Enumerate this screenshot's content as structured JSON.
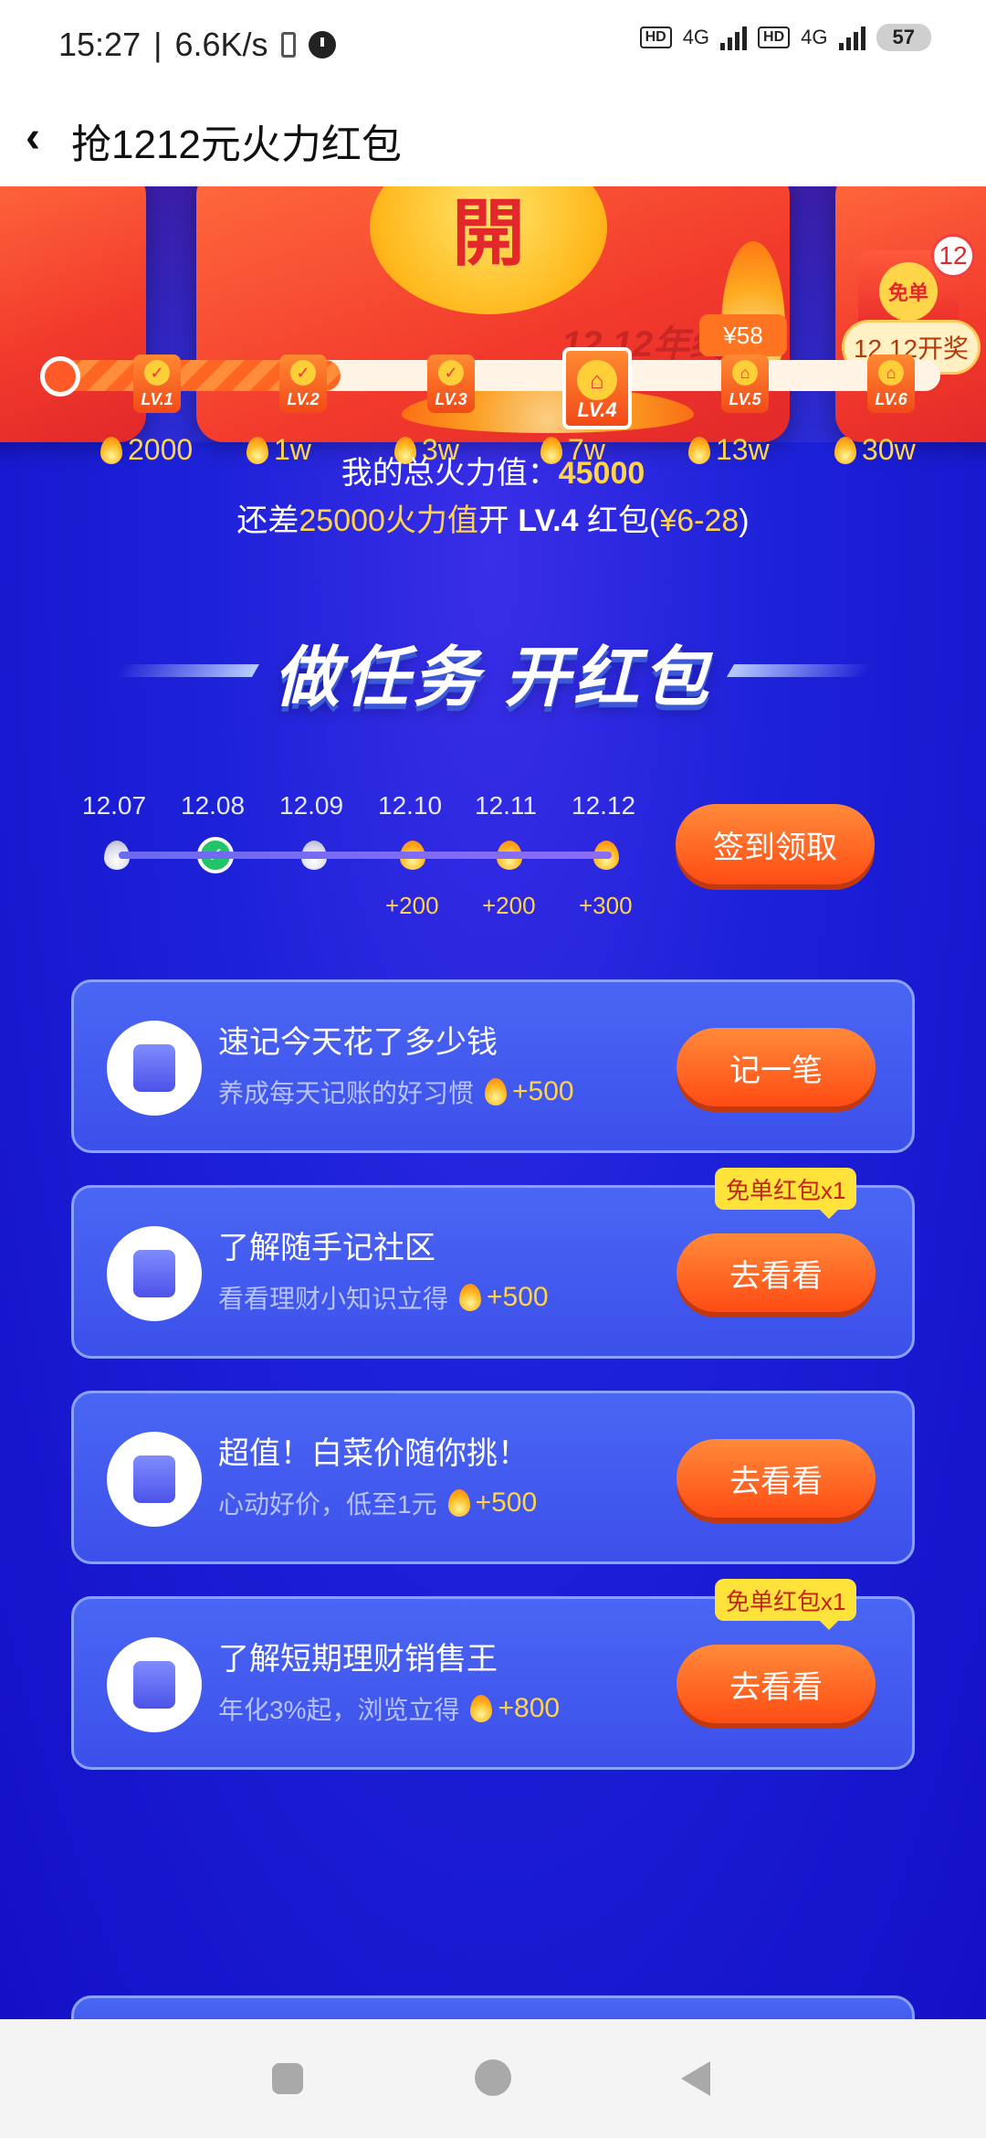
{
  "status_bar": {
    "time": "15:27",
    "net_speed": "6.6K/s",
    "hd1": "HD",
    "net1": "4G",
    "hd2": "HD",
    "net2": "4G",
    "battery": "57"
  },
  "header": {
    "title": "抢1212元火力红包",
    "back_icon": "chevron-left-icon"
  },
  "hero": {
    "open_char": "開",
    "slogan": "12.12年终狂欢",
    "free_badge": "免单",
    "free_count": "12",
    "draw_tag": "12.12开奖"
  },
  "progress": {
    "price_tag": "¥58",
    "fill_fraction": 0.33,
    "levels": [
      {
        "label": "LV.1",
        "threshold": "2000",
        "status": "done"
      },
      {
        "label": "LV.2",
        "threshold": "1w",
        "status": "done"
      },
      {
        "label": "LV.3",
        "threshold": "3w",
        "status": "done"
      },
      {
        "label": "LV.4",
        "threshold": "7w",
        "status": "locked-current"
      },
      {
        "label": "LV.5",
        "threshold": "13w",
        "status": "locked"
      },
      {
        "label": "LV.6",
        "threshold": "30w",
        "status": "locked"
      }
    ]
  },
  "summary": {
    "total_label": "我的总火力值：",
    "total_value": "45000",
    "need_prefix": "还差",
    "need_value": "25000火力值",
    "need_mid": "开 ",
    "need_level": "LV.4",
    "need_suffix": " 红包(",
    "need_range": "¥6-28",
    "need_close": ")"
  },
  "section_title": "做任务 开红包",
  "checkin": {
    "days": [
      {
        "date": "12.07",
        "state": "missed",
        "bonus": ""
      },
      {
        "date": "12.08",
        "state": "checked",
        "bonus": ""
      },
      {
        "date": "12.09",
        "state": "missed",
        "bonus": ""
      },
      {
        "date": "12.10",
        "state": "upcoming",
        "bonus": "+200"
      },
      {
        "date": "12.11",
        "state": "upcoming",
        "bonus": "+200"
      },
      {
        "date": "12.12",
        "state": "upcoming",
        "bonus": "+300"
      }
    ],
    "button": "签到领取"
  },
  "tasks": [
    {
      "title": "速记今天花了多少钱",
      "subtitle": "养成每天记账的好习惯",
      "points": "+500",
      "button": "记一笔",
      "tip": "",
      "icon": "pen-icon"
    },
    {
      "title": "了解随手记社区",
      "subtitle": "看看理财小知识立得",
      "points": "+500",
      "button": "去看看",
      "tip": "免单红包x1",
      "icon": "book-icon"
    },
    {
      "title": "超值！白菜价随你挑！",
      "subtitle": "心动好价，低至1元",
      "points": "+500",
      "button": "去看看",
      "tip": "",
      "icon": "shopping-bag-icon"
    },
    {
      "title": "了解短期理财销售王",
      "subtitle": "年化3%起，浏览立得",
      "points": "+800",
      "button": "去看看",
      "tip": "免单红包x1",
      "icon": "coin-stack-icon"
    }
  ],
  "colors": {
    "background": "#1a1fd6",
    "accent_orange": "#ff5a1e",
    "gold": "#ffd34a"
  }
}
